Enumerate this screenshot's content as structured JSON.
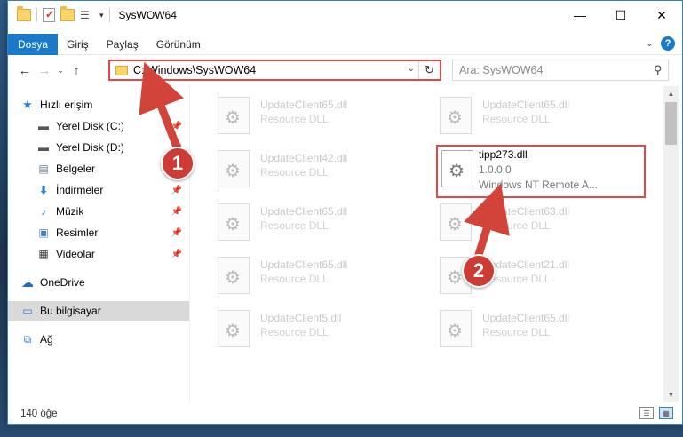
{
  "window": {
    "title": "SysWOW64"
  },
  "ribbon": {
    "tabs": [
      "Dosya",
      "Giriş",
      "Paylaş",
      "Görünüm"
    ]
  },
  "address": {
    "path": "C:\\Windows\\SysWOW64"
  },
  "search": {
    "placeholder": "Ara: SysWOW64"
  },
  "sidebar": {
    "items": [
      {
        "label": "Hızlı erişim",
        "icon": "star-icon",
        "pinned": false
      },
      {
        "label": "Yerel Disk (C:)",
        "icon": "drive-icon",
        "pinned": true
      },
      {
        "label": "Yerel Disk (D:)",
        "icon": "drive-icon",
        "pinned": true
      },
      {
        "label": "Belgeler",
        "icon": "documents-icon",
        "pinned": true
      },
      {
        "label": "İndirmeler",
        "icon": "download-icon",
        "pinned": true
      },
      {
        "label": "Müzik",
        "icon": "music-icon",
        "pinned": true
      },
      {
        "label": "Resimler",
        "icon": "pictures-icon",
        "pinned": true
      },
      {
        "label": "Videolar",
        "icon": "videos-icon",
        "pinned": true
      },
      {
        "label": "OneDrive",
        "icon": "cloud-icon",
        "pinned": false
      },
      {
        "label": "Bu bilgisayar",
        "icon": "computer-icon",
        "pinned": false
      },
      {
        "label": "Ağ",
        "icon": "network-icon",
        "pinned": false
      }
    ]
  },
  "files": [
    {
      "name": "UpdateClient65.dll",
      "desc": "Resource DLL"
    },
    {
      "name": "UpdateClient65.dll",
      "desc": "Resource DLL"
    },
    {
      "name": "UpdateClient42.dll",
      "desc": "Resource DLL"
    },
    {
      "name": "tipp273.dll",
      "version": "1.0.0.0",
      "desc": "Windows NT Remote A..."
    },
    {
      "name": "UpdateClient65.dll",
      "desc": "Resource DLL"
    },
    {
      "name": "UpdateClient63.dll",
      "desc": "Resource DLL"
    },
    {
      "name": "UpdateClient65.dll",
      "desc": "Resource DLL"
    },
    {
      "name": "UpdateClient21.dll",
      "desc": "Resource DLL"
    },
    {
      "name": "UpdateClient5.dll",
      "desc": "Resource DLL"
    },
    {
      "name": "UpdateClient65.dll",
      "desc": "Resource DLL"
    }
  ],
  "status": {
    "count": "140 öğe"
  },
  "annotations": {
    "step1": "1",
    "step2": "2"
  },
  "colors": {
    "accent": "#1979ca",
    "highlight": "#e24848",
    "badge": "#cc3c34"
  }
}
